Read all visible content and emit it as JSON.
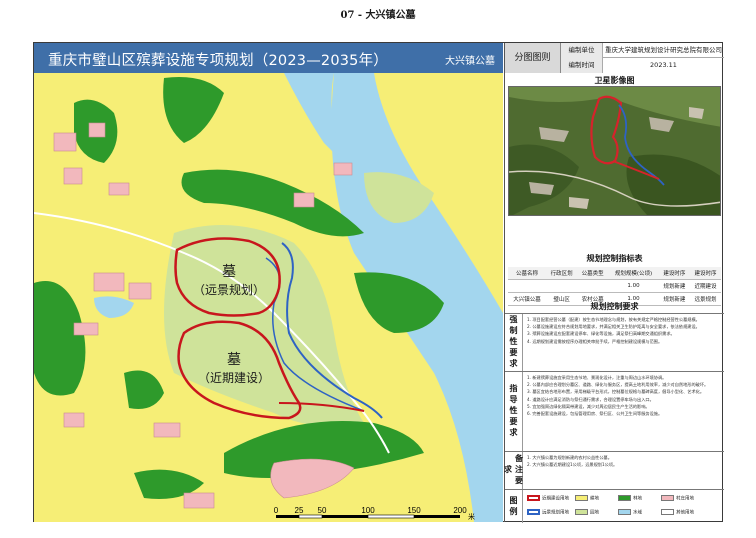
{
  "page_title": "07 - 大兴镇公墓",
  "header": {
    "title": "重庆市璧山区殡葬设施专项规划（2023—2035年）",
    "subtitle": "大兴镇公墓",
    "section_label": "分图图则",
    "compiler_key": "编制单位",
    "compiler_value": "重庆大学建筑规划设计研究总院有限公司",
    "time_key": "编制时间",
    "time_value": "2023.11"
  },
  "map": {
    "label_far_1": "墓",
    "label_far_2": "（远景规划）",
    "label_near_1": "墓",
    "label_near_2": "（近期建设）",
    "colors": {
      "yellow": "#f6ee76",
      "green": "#2e9a2b",
      "light_green": "#cfe39a",
      "pink": "#f2b8bd",
      "blue": "#a3d6ee",
      "red_outline": "#c8161d",
      "blue_outline": "#2e63c4"
    }
  },
  "scale_bar": {
    "ticks": [
      "0",
      "25",
      "50",
      "100",
      "150",
      "200"
    ],
    "unit": "米"
  },
  "side": {
    "satellite_title": "卫星影像图",
    "index_title": "规划控制指标表",
    "index_headers": [
      "公墓名称",
      "行政区划",
      "公墓类型",
      "规划规模(公顷)",
      "建设时序",
      "建设时序"
    ],
    "index_rows": [
      [
        "",
        "",
        "",
        "1.00",
        "规划新建",
        "近期建设"
      ],
      [
        "大兴镇公墓",
        "璧山区",
        "农村公墓",
        "1.00",
        "规划新建",
        "远景规划"
      ]
    ],
    "requirements_title": "规划控制要求",
    "mandatory_label": "强制性要求",
    "mandatory_items": [
      "1. 项目配套经营公墓（配建）按生态节地理念与规划，按有关规定严格控制经营性公墓规模。",
      "2. 公墓设施建设应符合规划用地要求，并满足相关卫生防护距离与安全要求，依法依规建设。",
      "3. 殡葬设施建设应配套建设停车、绿化等设施，满足祭扫高峰期交通组织需求。",
      "4. 远期规划建设需按程序办理相关审批手续，严格控制建设规模与范围。"
    ],
    "guidance_label": "指导性要求",
    "guidance_items": [
      "1. 新建殡葬设施宜采用生态节地、景观化设计，注重与周边山水环境协调。",
      "2. 公墓内部应合理划分墓区、道路、绿化与服务区，提高土地利用效率，减少对自然地形的破坏。",
      "3. 墓区宜结合地形布置，采用梯级平台形式，控制墓位规格与墓碑高度，倡导小型化、艺术化。",
      "4. 道路设计应满足消防与祭扫通行需求，合理设置停车场与出入口。",
      "5. 宜加强周边绿化隔离带建设，减少对周边居民生产生活的影响。",
      "6. 完善配套设施建设，包括管理用房、祭扫区、公共卫生间等服务设施。"
    ],
    "notes_label": "备注要求",
    "notes_items": [
      "1. 大兴镇公墓为规划新建的农村公益性公墓。",
      "2. 大兴镇公墓近期建设1公顷，远景规划1公顷。"
    ],
    "legend_label": "图例",
    "legend_items": [
      "近期建设用地",
      "远景规划用地",
      "耕地",
      "林地",
      "村庄用地",
      "园地",
      "水域",
      "其他用地"
    ]
  }
}
